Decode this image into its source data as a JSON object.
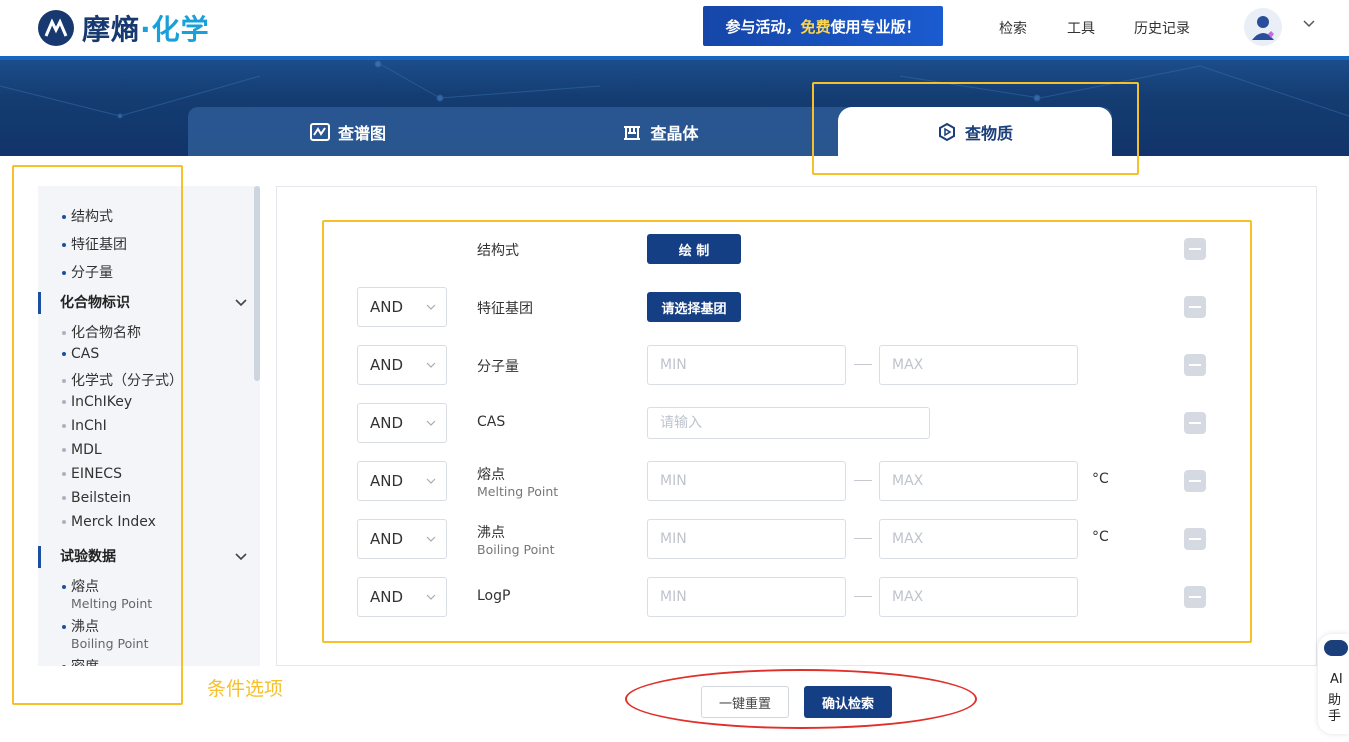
{
  "header": {
    "logo_text_1": "摩熵",
    "logo_dot": "·",
    "logo_text_2": "化学",
    "promo_pre": "参与活动，",
    "promo_free": "免费",
    "promo_post": "使用专业版！",
    "nav": [
      "检索",
      "工具",
      "历史记录"
    ]
  },
  "tabs": [
    {
      "label": "查谱图",
      "icon": "spectrum-icon"
    },
    {
      "label": "查晶体",
      "icon": "crystal-icon"
    },
    {
      "label": "查物质",
      "icon": "hexagon-icon",
      "active": true
    }
  ],
  "sidebar": {
    "top_items": [
      "结构式",
      "特征基团",
      "分子量"
    ],
    "sections": [
      {
        "title": "化合物标识",
        "items": [
          "化合物名称",
          "CAS",
          "化学式（分子式）",
          "InChIKey",
          "InChI",
          "MDL",
          "EINECS",
          "Beilstein",
          "Merck Index"
        ]
      },
      {
        "title": "试验数据",
        "items": [
          {
            "label": "熔点",
            "en": "Melting Point"
          },
          {
            "label": "沸点",
            "en": "Boiling Point"
          },
          {
            "label": "密度",
            "en": ""
          }
        ]
      }
    ]
  },
  "form": {
    "rows": [
      {
        "label": "结构式",
        "button": "绘 制"
      },
      {
        "logic": "AND",
        "label": "特征基团",
        "button": "请选择基团"
      },
      {
        "logic": "AND",
        "label": "分子量",
        "min": "MIN",
        "max": "MAX"
      },
      {
        "logic": "AND",
        "label": "CAS",
        "placeholder": "请输入"
      },
      {
        "logic": "AND",
        "label": "熔点",
        "en": "Melting Point",
        "min": "MIN",
        "max": "MAX",
        "unit": "°C"
      },
      {
        "logic": "AND",
        "label": "沸点",
        "en": "Boiling Point",
        "min": "MIN",
        "max": "MAX",
        "unit": "°C"
      },
      {
        "logic": "AND",
        "label": "LogP",
        "min": "MIN",
        "max": "MAX"
      }
    ]
  },
  "actions": {
    "reset": "一键重置",
    "confirm": "确认检索"
  },
  "annotation": "条件选项",
  "ai": {
    "line1": "AI",
    "line2": "助",
    "line3": "手"
  },
  "colors": {
    "brand": "#153f84",
    "accent": "#1aa0d8",
    "highlight": "#f6c02c",
    "circle": "#e0302a"
  }
}
